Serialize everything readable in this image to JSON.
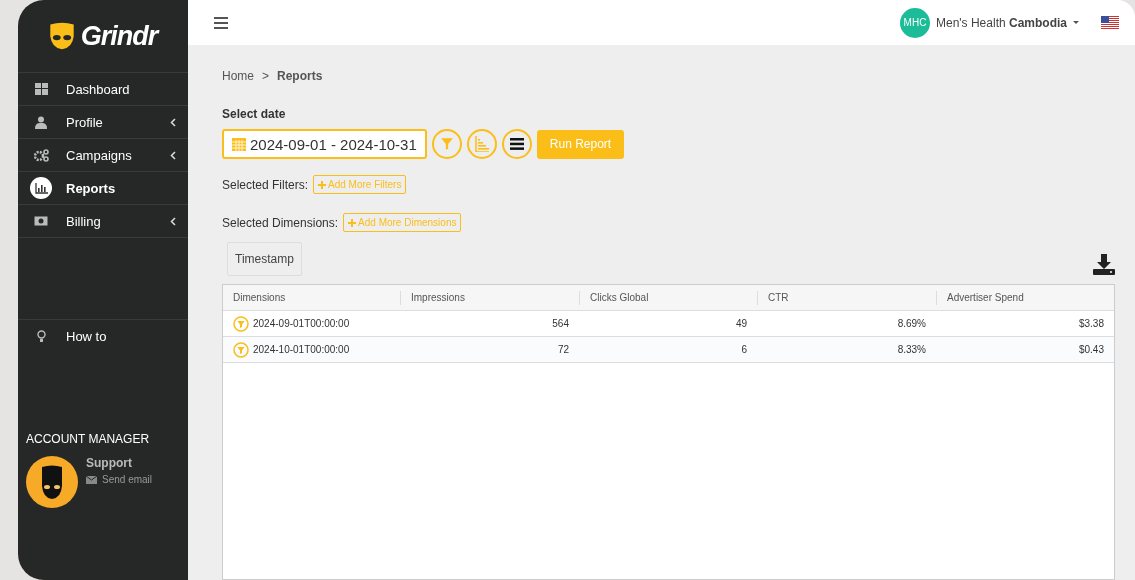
{
  "sidebar": {
    "brand": "Grindr",
    "items": [
      {
        "label": "Dashboard",
        "selected": false,
        "expandable": false
      },
      {
        "label": "Profile",
        "selected": false,
        "expandable": true
      },
      {
        "label": "Campaigns",
        "selected": false,
        "expandable": true
      },
      {
        "label": "Reports",
        "selected": true,
        "expandable": false
      },
      {
        "label": "Billing",
        "selected": false,
        "expandable": true
      }
    ],
    "help_item": {
      "label": "How to"
    },
    "account_manager": {
      "heading": "ACCOUNT MANAGER",
      "name": "Support",
      "link": "Send email"
    }
  },
  "topbar": {
    "avatar_initials": "MHC",
    "account_name": "Men's Health ",
    "account_name_bold": "Cambodia"
  },
  "breadcrumb": [
    {
      "label": "Home",
      "selected": false
    },
    {
      "label": "Reports",
      "selected": true
    }
  ],
  "breadcrumb_separator": ">",
  "date_label": "Select date",
  "date_range": "2024-09-01 - 2024-10-31",
  "run_button": "Run Report",
  "filters": {
    "label": "Selected Filters:",
    "button": "Add More Filters"
  },
  "dimensions": {
    "label": "Selected Dimensions:",
    "button": "Add More Dimensions",
    "chips": [
      "Timestamp"
    ]
  },
  "table": {
    "columns": [
      "Dimensions",
      "Impressions",
      "Clicks Global",
      "CTR",
      "Advertiser Spend"
    ],
    "rows": [
      [
        "2024-09-01T00:00:00",
        "564",
        "49",
        "8.69%",
        "$3.38"
      ],
      [
        "2024-10-01T00:00:00",
        "72",
        "6",
        "8.33%",
        "$0.43"
      ]
    ]
  }
}
